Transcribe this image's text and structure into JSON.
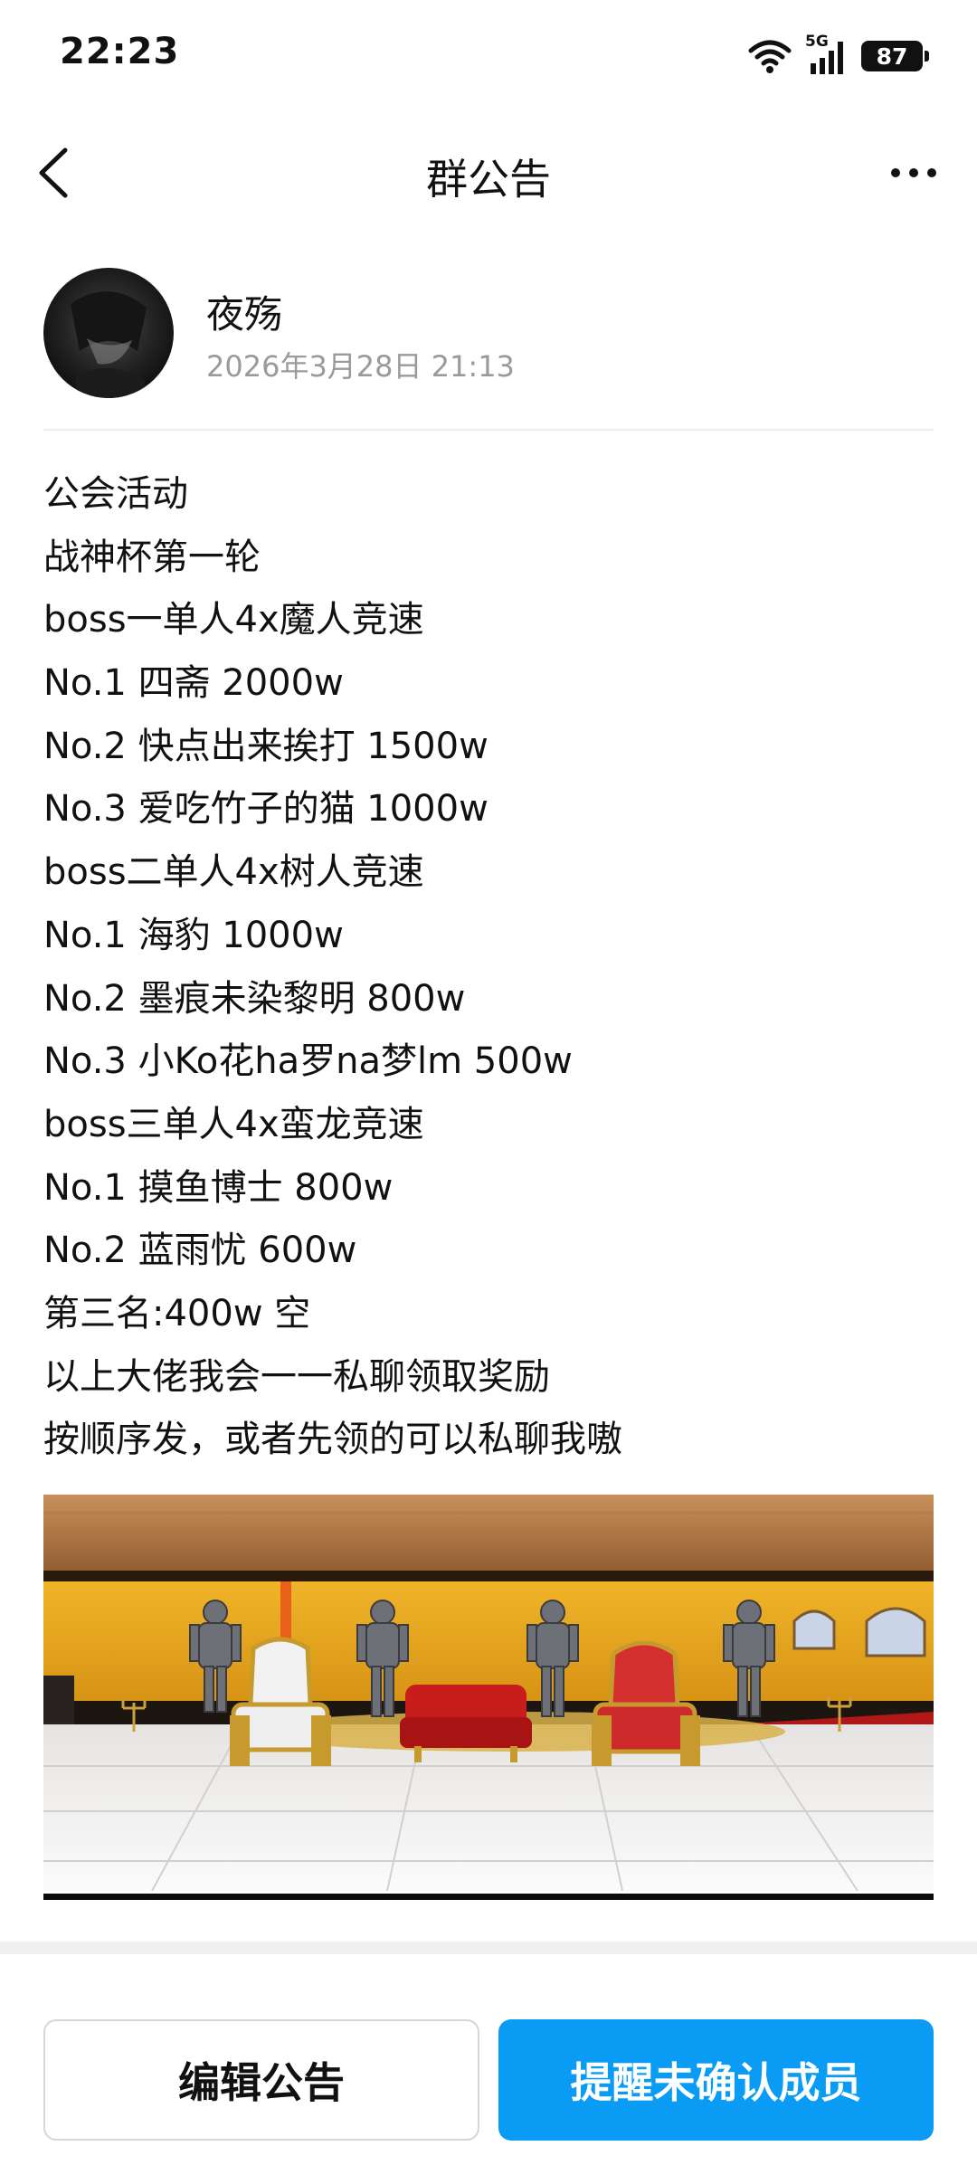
{
  "status_bar": {
    "time": "22:23",
    "network": "5G",
    "battery": "87",
    "icons": [
      "wifi-icon",
      "signal-icon",
      "battery-icon"
    ]
  },
  "header": {
    "title": "群公告",
    "back_icon": "chevron-left-icon",
    "more_icon": "more-horizontal-icon"
  },
  "author": {
    "name": "夜殇",
    "date": "2026年3月28日 21:13"
  },
  "announcement": {
    "lines": [
      "公会活动",
      "战神杯第一轮",
      "boss一单人4x魔人竞速",
      "No.1 四斋 2000w",
      "No.2 快点出来挨打 1500w",
      "No.3 爱吃竹子的猫 1000w",
      "boss二单人4x树人竞速",
      "No.1 海豹 1000w",
      "No.2 墨痕未染黎明 800w",
      "No.3 小Ko花ha罗na梦lm 500w",
      "boss三单人4x蛮龙竞速",
      "No.1 摸鱼博士 800w",
      "No.2 蓝雨忧 600w",
      "第三名:400w 空",
      "以上大佬我会一一私聊领取奖励",
      "按顺序发，或者先领的可以私聊我嗷"
    ]
  },
  "actions": {
    "edit_label": "编辑公告",
    "remind_label": "提醒未确认成员"
  },
  "colors": {
    "accent": "#0a9bf5",
    "date_text": "#9a9a9a",
    "divider": "#ececec"
  }
}
